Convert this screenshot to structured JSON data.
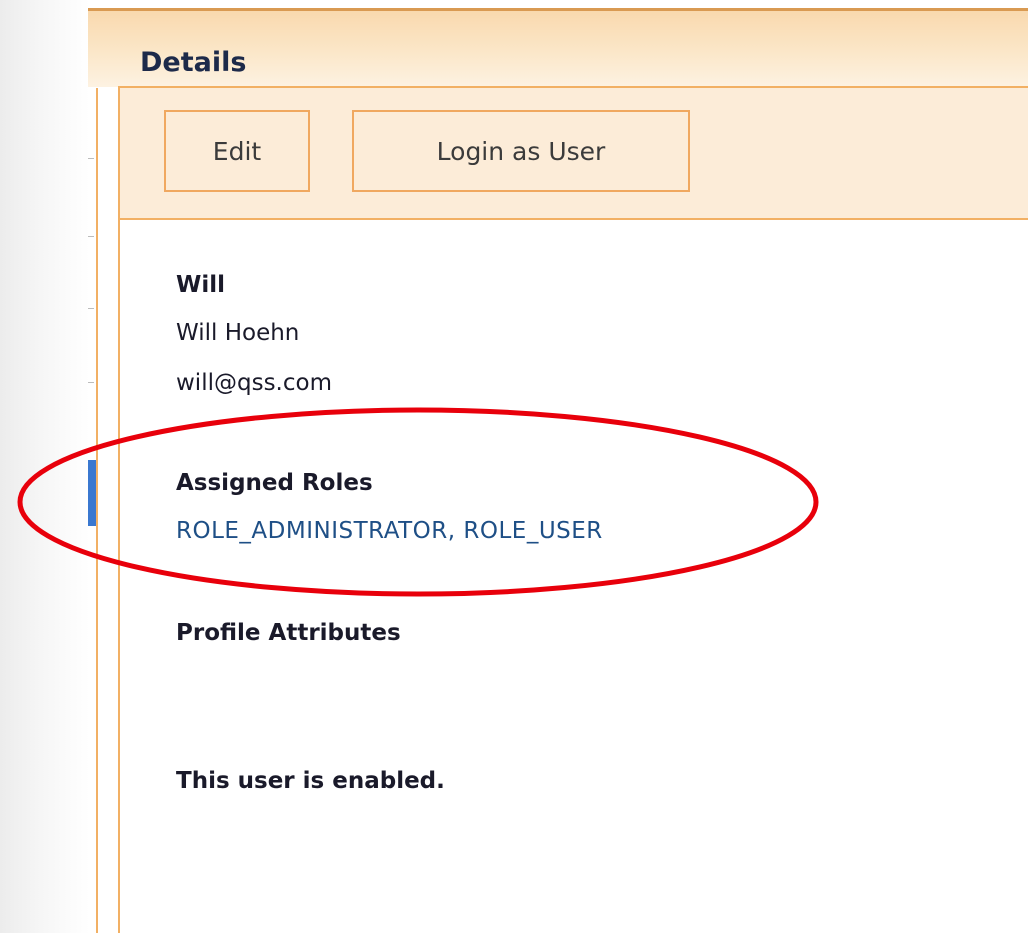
{
  "header": {
    "title": "Details"
  },
  "toolbar": {
    "edit_label": "Edit",
    "login_as_user_label": "Login as User"
  },
  "user": {
    "username": "Will",
    "full_name": "Will Hoehn",
    "email": "will@qss.com"
  },
  "roles": {
    "heading": "Assigned Roles",
    "value": "ROLE_ADMINISTRATOR, ROLE_USER"
  },
  "profile": {
    "heading": "Profile Attributes"
  },
  "status": {
    "text": "This user is enabled."
  },
  "colors": {
    "accent_border": "#f2b064",
    "header_gradient_top": "#f9d9ae",
    "toolbar_bg": "#fcecd8",
    "role_link": "#1e4f86",
    "annotation": "#e8000b",
    "nav_selected": "#3a78d0"
  }
}
